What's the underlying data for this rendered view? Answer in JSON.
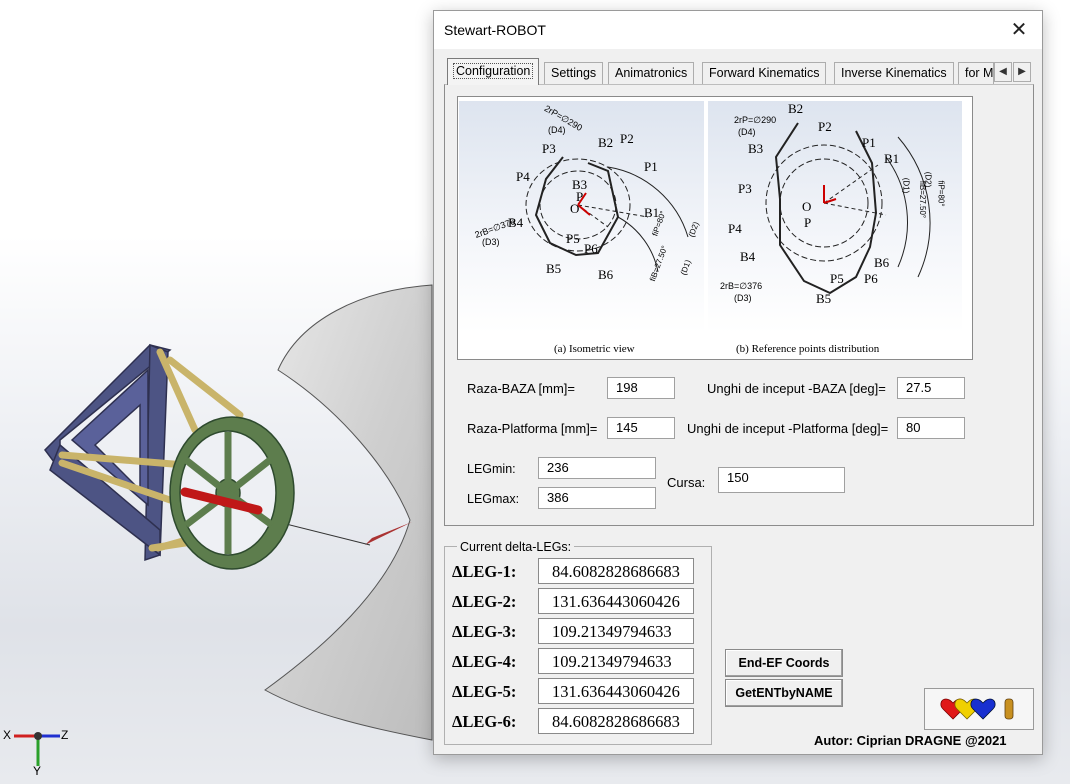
{
  "dialog": {
    "title": "Stewart-ROBOT"
  },
  "tabs": [
    {
      "label": "Configuration",
      "active": true
    },
    {
      "label": "Settings"
    },
    {
      "label": "Animatronics"
    },
    {
      "label": "Forward Kinematics"
    },
    {
      "label": "Inverse Kinematics"
    },
    {
      "label": "for M"
    }
  ],
  "figure": {
    "caption_a": "(a)      Isometric view",
    "caption_b": "(b) Reference points distribution",
    "labels": {
      "B1": "B1",
      "B2": "B2",
      "B3": "B3",
      "B4": "B4",
      "B5": "B5",
      "B6": "B6",
      "P1": "P1",
      "P2": "P2",
      "P3": "P3",
      "P4": "P4",
      "P5": "P5",
      "P6": "P6",
      "O": "O",
      "P": "P",
      "rp": "2rP=∅290",
      "rb": "2rB=∅376",
      "d1": "(D1)",
      "d2": "(D2)",
      "d3": "(D3)",
      "d4": "(D4)",
      "fib": "fiB=27.50°",
      "fip": "fiP=80°"
    }
  },
  "config": {
    "raza_baza_label": "Raza-BAZA [mm]=",
    "raza_baza_value": "198",
    "unghi_baza_label": "Unghi de inceput -BAZA [deg]=",
    "unghi_baza_value": "27.5",
    "raza_platforma_label": "Raza-Platforma [mm]=",
    "raza_platforma_value": "145",
    "unghi_platforma_label": "Unghi de inceput -Platforma [deg]=",
    "unghi_platforma_value": "80",
    "legmin_label": "LEGmin:",
    "legmin_value": "236",
    "legmax_label": "LEGmax:",
    "legmax_value": "386",
    "cursa_label": "Cursa:",
    "cursa_value": "150"
  },
  "delta_legs": {
    "title": "Current delta-LEGs:",
    "legs": [
      {
        "label": "ΔLEG-1:",
        "value": "84.6082828686683"
      },
      {
        "label": "ΔLEG-2:",
        "value": "131.636443060426"
      },
      {
        "label": "ΔLEG-3:",
        "value": "109.21349794633"
      },
      {
        "label": "ΔLEG-4:",
        "value": "109.21349794633"
      },
      {
        "label": "ΔLEG-5:",
        "value": "131.636443060426"
      },
      {
        "label": "ΔLEG-6:",
        "value": "84.6082828686683"
      }
    ]
  },
  "buttons": {
    "end_ef": "End-EF Coords",
    "get_ent": "GetENTbyNAME"
  },
  "author": "Autor: Ciprian DRAGNE @2021",
  "axes": {
    "x": "X",
    "y": "Y",
    "z": "Z"
  },
  "colors": {
    "robot_frame": "#4a5080",
    "robot_platform": "#5a7a4a",
    "actuator": "#c9b46a",
    "rod": "#c01818",
    "workspace": "#d0d0d0"
  }
}
